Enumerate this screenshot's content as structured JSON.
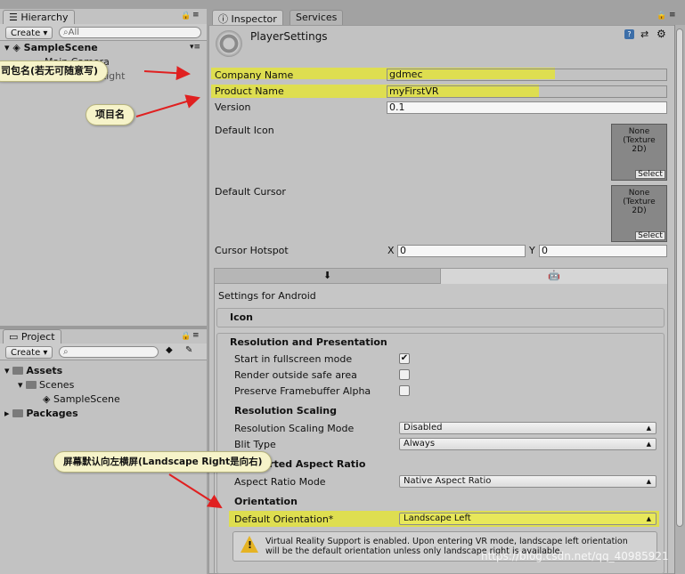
{
  "hierarchy": {
    "tab_label": "Hierarchy",
    "create_label": "Create",
    "search_placeholder": "All",
    "scene_name": "SampleScene",
    "items": [
      "Main Camera",
      "Directional Light"
    ]
  },
  "project": {
    "tab_label": "Project",
    "create_label": "Create",
    "tree": {
      "assets": "Assets",
      "scenes": "Scenes",
      "scene": "SampleScene",
      "packages": "Packages"
    }
  },
  "inspector": {
    "tab_label": "Inspector",
    "services_label": "Services",
    "title": "PlayerSettings",
    "company_name_label": "Company Name",
    "company_name_value": "gdmec",
    "product_name_label": "Product Name",
    "product_name_value": "myFirstVR",
    "version_label": "Version",
    "version_value": "0.1",
    "default_icon_label": "Default Icon",
    "default_cursor_label": "Default Cursor",
    "texture_none": "None\n(Texture\n2D)",
    "select_label": "Select",
    "cursor_hotspot_label": "Cursor Hotspot",
    "hotspot_x_label": "X",
    "hotspot_x_value": "0",
    "hotspot_y_label": "Y",
    "hotspot_y_value": "0",
    "settings_for": "Settings for Android",
    "icon_section": "Icon",
    "resolution_section": "Resolution and Presentation",
    "start_fullscreen": "Start in fullscreen mode",
    "render_outside": "Render outside safe area",
    "preserve_fb": "Preserve Framebuffer Alpha",
    "resolution_scaling": "Resolution Scaling",
    "scaling_mode_label": "Resolution Scaling Mode",
    "scaling_mode_value": "Disabled",
    "blit_type_label": "Blit Type",
    "blit_type_value": "Always",
    "supported_aspect": "Supported Aspect Ratio",
    "aspect_mode_label": "Aspect Ratio Mode",
    "aspect_mode_value": "Native Aspect Ratio",
    "orientation_section": "Orientation",
    "default_orientation_label": "Default Orientation*",
    "default_orientation_value": "Landscape Left",
    "vr_warning_line1": "Virtual Reality Support is enabled. Upon entering VR mode, landscape left orientation",
    "vr_warning_line2": "will be the default orientation unless only landscape right is available."
  },
  "annotations": {
    "company": "司包名(若无可随意写)",
    "product": "项目名",
    "orientation": "屏幕默认向左横屏(Landscape Right是向右)"
  },
  "watermark": "https://blog.csdn.net/qq_40985921",
  "colors": {
    "highlight": "#e3e33c",
    "callout_bg": "#f6f3c9",
    "arrow": "#e02020",
    "panel_bg": "#c2c2c2"
  }
}
